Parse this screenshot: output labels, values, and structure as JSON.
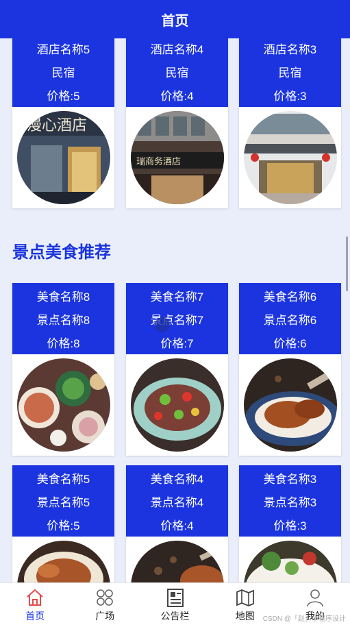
{
  "header": {
    "title": "首页"
  },
  "hotels": [
    {
      "name": "酒店名称5",
      "type": "民宿",
      "price": "价格:5",
      "sign": "漫心酒店"
    },
    {
      "name": "酒店名称4",
      "type": "民宿",
      "price": "价格:4",
      "sign": "瑞商务酒店"
    },
    {
      "name": "酒店名称3",
      "type": "民宿",
      "price": "价格:3",
      "sign": ""
    }
  ],
  "section": {
    "title": "景点美食推荐"
  },
  "foods_row1": [
    {
      "name": "美食名称8",
      "spot": "景点名称8",
      "price": "价格:8"
    },
    {
      "name": "美食名称7",
      "spot": "景点名称7",
      "price": "价格:7"
    },
    {
      "name": "美食名称6",
      "spot": "景点名称6",
      "price": "价格:6"
    }
  ],
  "foods_row2": [
    {
      "name": "美食名称5",
      "spot": "景点名称5",
      "price": "价格:5"
    },
    {
      "name": "美食名称4",
      "spot": "景点名称4",
      "price": "价格:4"
    },
    {
      "name": "美食名称3",
      "spot": "景点名称3",
      "price": "价格:3"
    }
  ],
  "tabbar": [
    {
      "label": "首页",
      "icon": "home-icon",
      "active": true
    },
    {
      "label": "广场",
      "icon": "grid-icon",
      "active": false
    },
    {
      "label": "公告栏",
      "icon": "notice-icon",
      "active": false
    },
    {
      "label": "地图",
      "icon": "map-icon",
      "active": false
    },
    {
      "label": "我的",
      "icon": "user-icon",
      "active": false
    }
  ],
  "watermark": "CSDN @「赵」小程序设计",
  "colors": {
    "primary": "#1b34e0",
    "background": "#e9eefa"
  }
}
